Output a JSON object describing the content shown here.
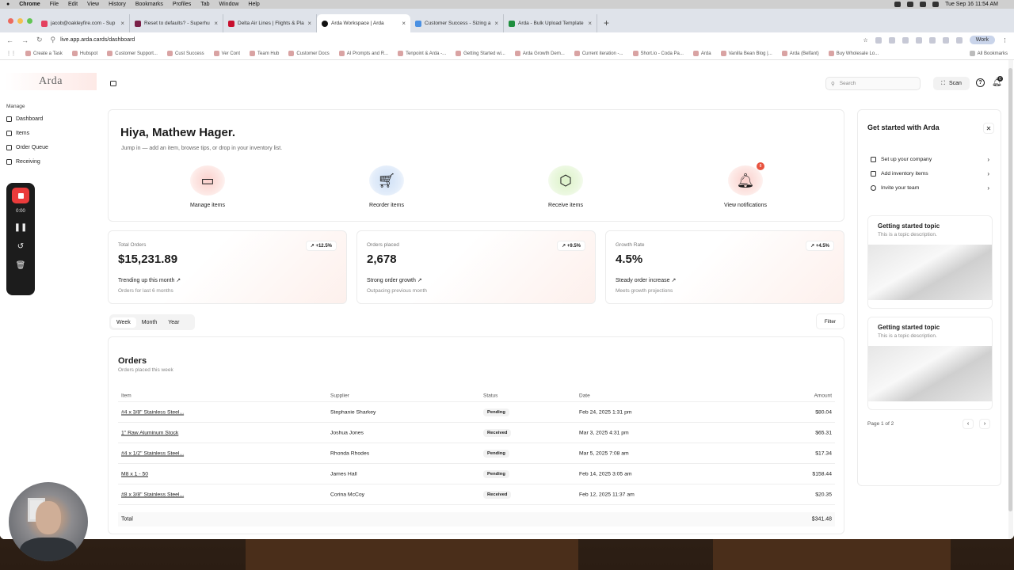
{
  "menubar": {
    "app": "Chrome",
    "items": [
      "File",
      "Edit",
      "View",
      "History",
      "Bookmarks",
      "Profiles",
      "Tab",
      "Window",
      "Help"
    ],
    "clock": "Tue Sep 16  11:54 AM"
  },
  "tabs": [
    {
      "title": "jacob@oakleyfire.com - Sup",
      "color": "#e4405f"
    },
    {
      "title": "Reset to defaults? - Superhu",
      "color": "#7a2048"
    },
    {
      "title": "Delta Air Lines | Flights & Pla",
      "color": "#c8102e"
    },
    {
      "title": "Arda Workspace | Arda",
      "color": "#111111"
    },
    {
      "title": "Customer Success - Sizing a",
      "color": "#4a90e2"
    },
    {
      "title": "Arda - Bulk Upload Template",
      "color": "#1e8e3e"
    }
  ],
  "address": {
    "url": "live.app.arda.cards/dashboard",
    "profile": "Work"
  },
  "bookmarks": [
    "Create a Task",
    "Hubspot",
    "Customer Support...",
    "Cust Success",
    "Ver Cont",
    "Team Hub",
    "Customer Docs",
    "AI Prompts and R...",
    "Tenpoint & Arda -...",
    "Getting Started wi...",
    "Arda Growth Dem...",
    "Current iteration -...",
    "Short.io - Coda Pa...",
    "Arda",
    "Vanilla Bean Blog |...",
    "Arda (Belfant)",
    "Buy Wholesale Lo..."
  ],
  "bookmarks_all": "All Bookmarks",
  "sidebar": {
    "logo": "Arda",
    "section": "Manage",
    "items": [
      "Dashboard",
      "Items",
      "Order Queue",
      "Receiving"
    ]
  },
  "recorder": {
    "time": "0:00"
  },
  "header": {
    "search_placeholder": "Search",
    "scan": "Scan",
    "notif_count": "0"
  },
  "hero": {
    "title": "Hiya, Mathew Hager.",
    "subtitle": "Jump in — add an item, browse tips, or drop in your inventory list.",
    "actions": [
      {
        "label": "Manage items",
        "icon": "card-icon"
      },
      {
        "label": "Reorder items",
        "icon": "cart-icon"
      },
      {
        "label": "Receive items",
        "icon": "package-icon"
      },
      {
        "label": "View notifications",
        "icon": "bell-icon",
        "badge": "8"
      }
    ]
  },
  "stats": [
    {
      "label": "Total Orders",
      "value": "$15,231.89",
      "change": "+12.5%",
      "trend": "Trending up this month",
      "note": "Orders for last 6 months"
    },
    {
      "label": "Orders placed",
      "value": "2,678",
      "change": "+9.5%",
      "trend": "Strong order growth",
      "note": "Outpacing previous month"
    },
    {
      "label": "Growth Rate",
      "value": "4.5%",
      "change": "+4.5%",
      "trend": "Steady order increase",
      "note": "Meets growth projections"
    }
  ],
  "period": [
    "Week",
    "Month",
    "Year"
  ],
  "filter": "Filter",
  "orders": {
    "title": "Orders",
    "subtitle": "Orders placed this week",
    "columns": [
      "Item",
      "Supplier",
      "Status",
      "Date",
      "Amount"
    ],
    "rows": [
      {
        "item": "#4 x 3/8\" Stainless Steel...",
        "supplier": "Stephanie Sharkey",
        "status": "Pending",
        "date": "Feb 24, 2025 1:31 pm",
        "amount": "$80.04"
      },
      {
        "item": "1\" Raw Aluminum Stock",
        "supplier": "Joshua Jones",
        "status": "Received",
        "date": "Mar 3, 2025 4:31 pm",
        "amount": "$65.31"
      },
      {
        "item": "#4 x 1/2\" Stainless Steel...",
        "supplier": "Rhonda Rhodes",
        "status": "Pending",
        "date": "Mar 5, 2025 7:08 am",
        "amount": "$17.34"
      },
      {
        "item": "M8 x 1 - 50",
        "supplier": "James Hall",
        "status": "Pending",
        "date": "Feb 14, 2025 3:05 am",
        "amount": "$158.44"
      },
      {
        "item": "#8 x 3/8\" Stainless Steel...",
        "supplier": "Corina McCoy",
        "status": "Received",
        "date": "Feb 12, 2025 11:37 am",
        "amount": "$20.35"
      }
    ],
    "total_label": "Total",
    "total": "$341.48"
  },
  "panel": {
    "title": "Get started with Arda",
    "links": [
      "Set up your company",
      "Add inventory items",
      "Invite your team"
    ],
    "topics": [
      {
        "title": "Getting started topic",
        "desc": "This is a topic description."
      },
      {
        "title": "Getting started topic",
        "desc": "This is a topic description."
      }
    ],
    "pager": "Page 1 of 2"
  }
}
